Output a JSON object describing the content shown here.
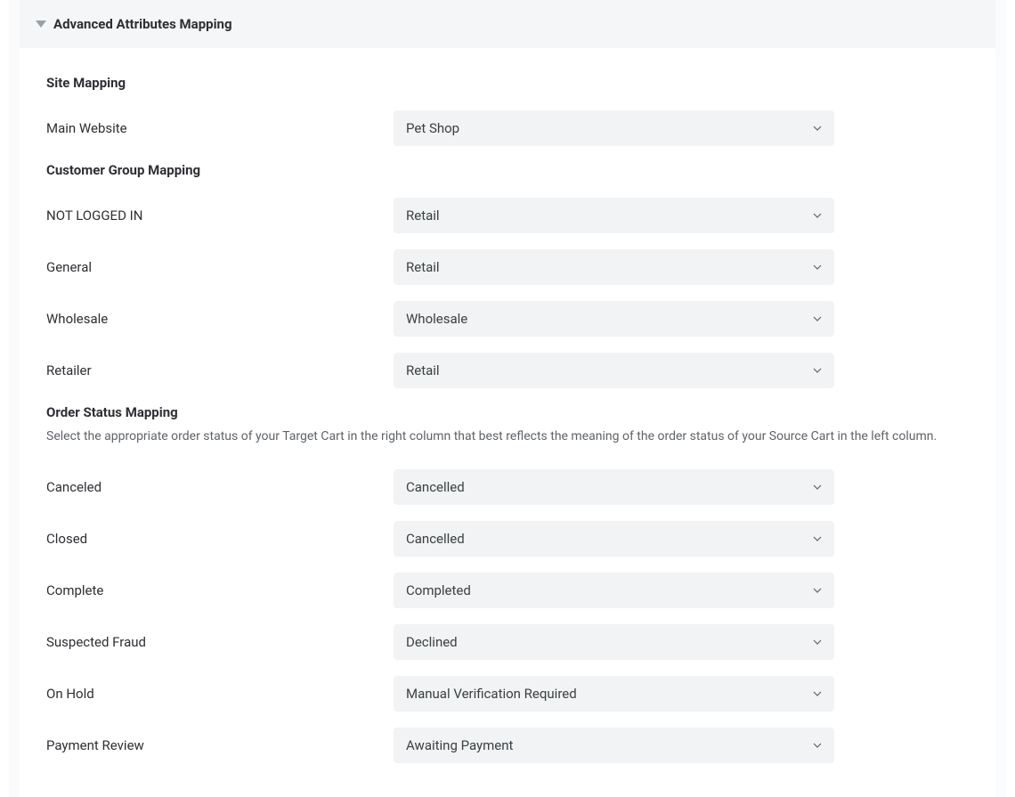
{
  "header": {
    "title": "Advanced Attributes Mapping"
  },
  "sections": {
    "site_mapping": {
      "heading": "Site Mapping",
      "rows": [
        {
          "label": "Main Website",
          "value": "Pet Shop"
        }
      ]
    },
    "customer_group_mapping": {
      "heading": "Customer Group Mapping",
      "rows": [
        {
          "label": "NOT LOGGED IN",
          "value": "Retail"
        },
        {
          "label": "General",
          "value": "Retail"
        },
        {
          "label": "Wholesale",
          "value": "Wholesale"
        },
        {
          "label": "Retailer",
          "value": "Retail"
        }
      ]
    },
    "order_status_mapping": {
      "heading": "Order Status Mapping",
      "description": "Select the appropriate order status of your Target Cart in the right column that best reflects the meaning of the order status of your Source Cart in the left column.",
      "rows": [
        {
          "label": "Canceled",
          "value": "Cancelled"
        },
        {
          "label": "Closed",
          "value": "Cancelled"
        },
        {
          "label": "Complete",
          "value": "Completed"
        },
        {
          "label": "Suspected Fraud",
          "value": "Declined"
        },
        {
          "label": "On Hold",
          "value": "Manual Verification Required"
        },
        {
          "label": "Payment Review",
          "value": "Awaiting Payment"
        }
      ]
    }
  }
}
